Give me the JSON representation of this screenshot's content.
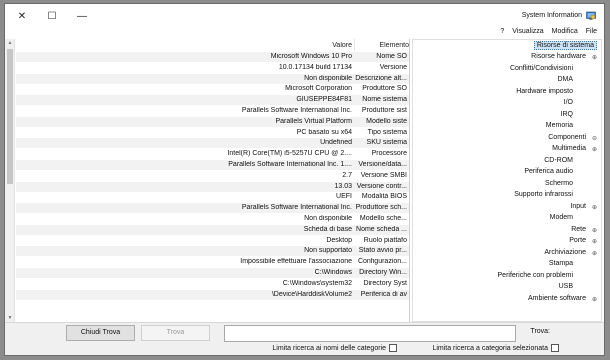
{
  "window": {
    "title": "System Information",
    "close_glyph": "✕",
    "maximize_glyph": "☐",
    "minimize_glyph": "—"
  },
  "menu": [
    "File",
    "Modifica",
    "Visualizza",
    "?"
  ],
  "tree": {
    "root": "Risorse di sistema",
    "items": [
      {
        "label": "Risorse hardware",
        "expander": "⊕"
      },
      {
        "label": "Conflitti/Condivisioni"
      },
      {
        "label": "DMA"
      },
      {
        "label": "Hardware imposto"
      },
      {
        "label": "I/O"
      },
      {
        "label": "IRQ"
      },
      {
        "label": "Memoria"
      },
      {
        "label": "Componenti",
        "expander": "⊖"
      },
      {
        "label": "Multimedia",
        "expander": "⊕"
      },
      {
        "label": "CD-ROM"
      },
      {
        "label": "Periferica audio"
      },
      {
        "label": "Schermo"
      },
      {
        "label": "Supporto infrarossi"
      },
      {
        "label": "Input",
        "expander": "⊕"
      },
      {
        "label": "Modem"
      },
      {
        "label": "Rete",
        "expander": "⊕"
      },
      {
        "label": "Porte",
        "expander": "⊕"
      },
      {
        "label": "Archiviazione",
        "expander": "⊕"
      },
      {
        "label": "Stampa"
      },
      {
        "label": "Periferiche con problemi"
      },
      {
        "label": "USB"
      },
      {
        "label": "Ambiente software",
        "expander": "⊕"
      }
    ]
  },
  "details": {
    "col_element": "Elemento",
    "col_value": "Valore",
    "rows": [
      {
        "el": "Nome SO",
        "val": "Microsoft Windows 10 Pro"
      },
      {
        "el": "Versione",
        "val": "10.0.17134 build 17134"
      },
      {
        "el": "Descrizione alt...",
        "val": "Non disponibile"
      },
      {
        "el": "Produttore SO",
        "val": "Microsoft Corporation"
      },
      {
        "el": "Nome sistema",
        "val": "GIUSEPPE84F81"
      },
      {
        "el": "Produttore sist",
        "val": "Parallels Software International Inc."
      },
      {
        "el": "Modello siste",
        "val": "Parallels Virtual Platform"
      },
      {
        "el": "Tipo sistema",
        "val": "PC basato su x64"
      },
      {
        "el": "SKU sistema",
        "val": "Undefined"
      },
      {
        "el": "Processore",
        "val": "Intel(R) Core(TM) i5-5257U CPU @ 2...."
      },
      {
        "el": "Versione/data...",
        "val": "Parallels Software International Inc. 1...."
      },
      {
        "el": "Versione SMBI",
        "val": "2.7"
      },
      {
        "el": "Versione contr...",
        "val": "13.03"
      },
      {
        "el": "Modalità BIOS",
        "val": "UEFI"
      },
      {
        "el": "Produttore sch...",
        "val": "Parallels Software International Inc."
      },
      {
        "el": "Modello sche...",
        "val": "Non disponibile"
      },
      {
        "el": "Nome scheda ...",
        "val": "Scheda di base"
      },
      {
        "el": "Ruolo piattafo",
        "val": "Desktop"
      },
      {
        "el": "Stato avvio pr...",
        "val": "Non supportato"
      },
      {
        "el": "Configurazion...",
        "val": "Impossibile effettuare l'associazione"
      },
      {
        "el": "Directory Win...",
        "val": "C:\\Windows"
      },
      {
        "el": "Directory Syst",
        "val": "C:\\Windows\\system32"
      },
      {
        "el": "Periferica di av",
        "val": "\\Device\\HarddiskVolume2"
      }
    ]
  },
  "find": {
    "label": "Trova:",
    "value": "",
    "find_button": "Trova",
    "close_find_button": "Chiudi Trova",
    "chk_selected_category": "Limita ricerca a categoria selezionata",
    "chk_category_names": "Limita ricerca ai nomi delle categorie"
  }
}
